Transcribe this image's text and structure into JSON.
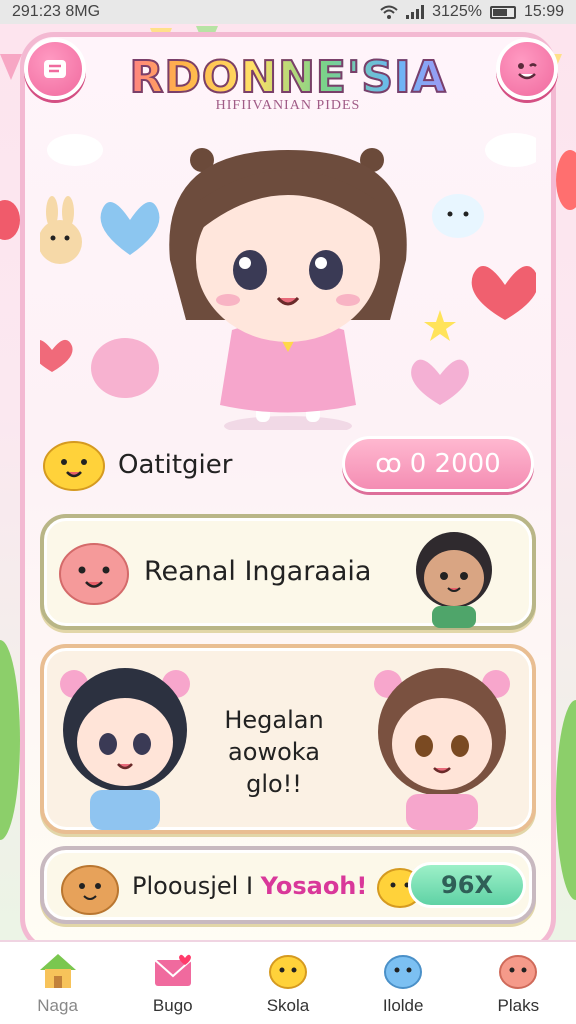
{
  "status_bar": {
    "time_left": "291:23 8MG",
    "battery": "3125%",
    "time_right": "15:99"
  },
  "header": {
    "title": "RDONNE'SIA",
    "subtitle": "HIFIIVANIAN PIDES",
    "menu_icon": "scroll-menu-icon",
    "profile_icon": "smiley-face-icon"
  },
  "currency": {
    "label": "Oatitgier",
    "value_prefix": "ꝏ",
    "value": "0 2000"
  },
  "cards": [
    {
      "label": "Reanal Ingaraaia"
    },
    {
      "label_lines": [
        "Hegalan",
        "aowoka",
        "glo!!"
      ]
    },
    {
      "label": "Ploousjel I",
      "accent": "Yosaoh!",
      "pill_value": "96X"
    }
  ],
  "nav": [
    {
      "label": "Naga",
      "icon": "house-icon"
    },
    {
      "label": "Bugo",
      "icon": "envelope-heart-icon"
    },
    {
      "label": "Skola",
      "icon": "yellow-blob-icon"
    },
    {
      "label": "Ilolde",
      "icon": "blue-blob-icon"
    },
    {
      "label": "Plaks",
      "icon": "orange-blob-icon"
    }
  ],
  "colors": {
    "panel_border": "#f3b9d2",
    "accent_pink": "#f06a9e",
    "pill_green": "#5fd2a5"
  }
}
